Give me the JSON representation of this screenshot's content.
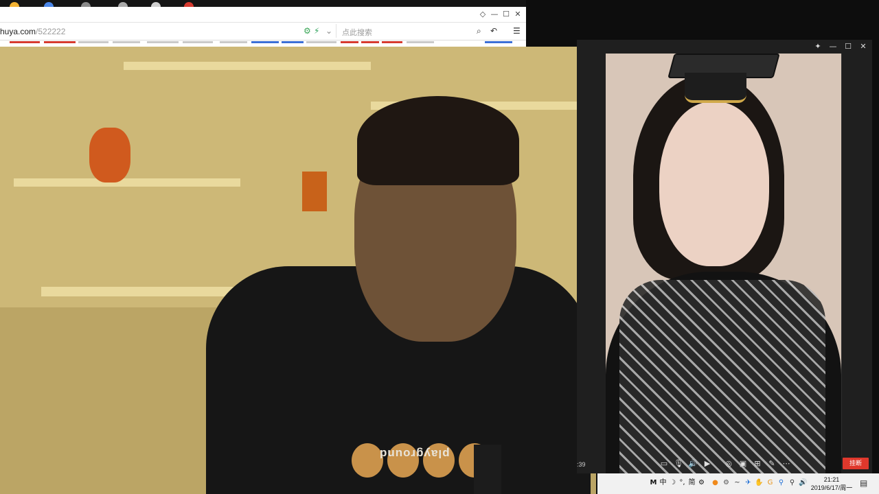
{
  "browser": {
    "url_host": "huya.com",
    "url_path": "/522222",
    "search_placeholder": "点此搜索",
    "window_buttons": {
      "restore": "◇",
      "minimize": "—",
      "maximize": "☐",
      "close": "✕"
    },
    "address_icons": {
      "gear": "⚙",
      "bolt": "⚡",
      "dropdown": "⌄",
      "search": "⌕",
      "undo": "↶",
      "menu": "☰"
    }
  },
  "call_window": {
    "title": "",
    "elapsed": ":39",
    "hangup_label": "挂断",
    "window_buttons": {
      "pin": "✦",
      "minimize": "—",
      "maximize": "☐",
      "close": "✕"
    },
    "controls": [
      {
        "name": "chat-icon",
        "glyph": "▭"
      },
      {
        "name": "microphone-icon",
        "glyph": "🎙"
      },
      {
        "name": "speaker-icon",
        "glyph": "🔊"
      },
      {
        "name": "camera-icon",
        "glyph": "▶"
      },
      {
        "name": "screenshot-icon",
        "glyph": "◎"
      },
      {
        "name": "record-icon",
        "glyph": "▣"
      },
      {
        "name": "layout-icon",
        "glyph": "⊞"
      },
      {
        "name": "edit-icon",
        "glyph": "✎"
      },
      {
        "name": "more-icon",
        "glyph": "⋯"
      }
    ]
  },
  "host_shirt_text": "playground",
  "taskbar": {
    "tray": [
      "M",
      "中",
      "☽",
      "°,",
      "简",
      "⚙",
      "●",
      "⚙",
      "~",
      "✈",
      "✋",
      "G",
      "⚲",
      "⚲",
      "◻",
      "🔊"
    ],
    "time": "21:21",
    "date": "2019/6/17/周一"
  },
  "colors": {
    "hangup": "#e0382c",
    "titlebar": "#1f1f1f",
    "taskbar": "#f1f1f1"
  }
}
